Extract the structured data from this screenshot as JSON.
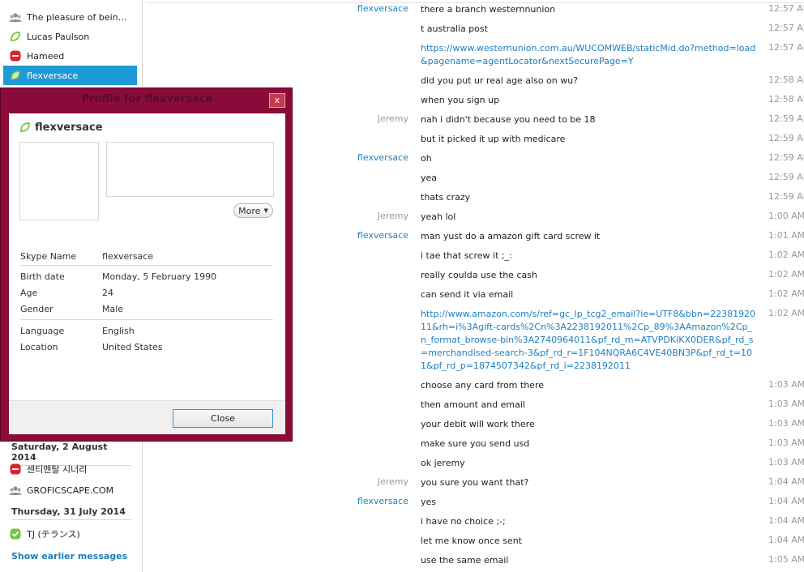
{
  "sidebar": {
    "contacts_top": [
      {
        "name": "The pleasure of being cu…",
        "icon": "group-icon"
      },
      {
        "name": "Lucas Paulson",
        "icon": "status-offline-icon"
      },
      {
        "name": "Hameed",
        "icon": "status-dnd-icon"
      },
      {
        "name": "flexversace",
        "icon": "status-offline-icon",
        "selected": true
      }
    ],
    "date_groups": [
      {
        "date": "Saturday, 2 August 2014",
        "contacts": [
          {
            "name": "센티멘탈 시너리",
            "icon": "status-dnd-icon"
          },
          {
            "name": "GROFICSCAPE.COM",
            "icon": "group-icon"
          }
        ]
      },
      {
        "date": "Thursday, 31 July 2014",
        "contacts": [
          {
            "name": "TJ (テランス)",
            "icon": "status-online-icon"
          }
        ]
      }
    ],
    "show_earlier_label": "Show earlier messages"
  },
  "chat": {
    "messages": [
      {
        "sender": "flexversace",
        "side": "them",
        "text": "there a branch westernnunion",
        "time": "12:57 AM"
      },
      {
        "sender": "",
        "side": "them",
        "text": "t australia post",
        "time": "12:57 AM"
      },
      {
        "sender": "",
        "side": "them",
        "text": "https://www.westernunion.com.au/WUCOMWEB/staticMid.do?method=load&pagename=agentLocator&nextSecurePage=Y",
        "time": "12:57 AM",
        "link": true,
        "lines": 2
      },
      {
        "sender": "",
        "side": "them",
        "text": "did you put ur real age also on wu?",
        "time": "12:58 AM"
      },
      {
        "sender": "",
        "side": "them",
        "text": "when you sign up",
        "time": "12:58 AM"
      },
      {
        "sender": "Jeremy",
        "side": "me",
        "text": "nah i didn't because you need to be 18",
        "time": "12:59 AM"
      },
      {
        "sender": "",
        "side": "me",
        "text": "but it picked it up with medicare",
        "time": "12:59 AM"
      },
      {
        "sender": "flexversace",
        "side": "them",
        "text": "oh",
        "time": "12:59 AM"
      },
      {
        "sender": "",
        "side": "them",
        "text": "yea",
        "time": "12:59 AM"
      },
      {
        "sender": "",
        "side": "them",
        "text": "thats crazy",
        "time": "12:59 AM"
      },
      {
        "sender": "Jeremy",
        "side": "me",
        "text": "yeah lol",
        "time": "1:00 AM"
      },
      {
        "sender": "flexversace",
        "side": "them",
        "text": "man yust do a amazon gift card screw it",
        "time": "1:01 AM"
      },
      {
        "sender": "",
        "side": "them",
        "text": "i tae that screw it ;_:",
        "time": "1:02 AM"
      },
      {
        "sender": "",
        "side": "them",
        "text": "really coulda use the cash",
        "time": "1:02 AM"
      },
      {
        "sender": "",
        "side": "them",
        "text": "can send it via email",
        "time": "1:02 AM"
      },
      {
        "sender": "",
        "side": "them",
        "text": "http://www.amazon.com/s/ref=gc_lp_tcg2_email?ie=UTF8&bbn=2238192011&rh=i%3Agift-cards%2Cn%3A2238192011%2Cp_89%3AAmazon%2Cp_n_format_browse-bin%3A2740964011&pf_rd_m=ATVPDKIKX0DER&pf_rd_s=merchandised-search-3&pf_rd_r=1F104NQRA6C4VE40BN3P&pf_rd_t=101&pf_rd_p=1874507342&pf_rd_i=2238192011",
        "time": "1:02 AM",
        "link": true,
        "lines": 5
      },
      {
        "sender": "",
        "side": "them",
        "text": "choose any card from there",
        "time": "1:03 AM"
      },
      {
        "sender": "",
        "side": "them",
        "text": "then amount and email",
        "time": "1:03 AM"
      },
      {
        "sender": "",
        "side": "them",
        "text": "your debit will work there",
        "time": "1:03 AM"
      },
      {
        "sender": "",
        "side": "them",
        "text": "make sure you send usd",
        "time": "1:03 AM"
      },
      {
        "sender": "",
        "side": "them",
        "text": "ok jeremy",
        "time": "1:03 AM"
      },
      {
        "sender": "Jeremy",
        "side": "me",
        "text": "you sure you want that?",
        "time": "1:04 AM"
      },
      {
        "sender": "flexversace",
        "side": "them",
        "text": "yes",
        "time": "1:04 AM"
      },
      {
        "sender": "",
        "side": "them",
        "text": "i have no choice ;-;",
        "time": "1:04 AM"
      },
      {
        "sender": "",
        "side": "them",
        "text": "let me know once sent",
        "time": "1:04 AM"
      },
      {
        "sender": "",
        "side": "them",
        "text": "use the same email",
        "time": "1:05 AM"
      }
    ]
  },
  "profile_dialog": {
    "title": "Profile for flexversace",
    "close_x": "x",
    "name": "flexversace",
    "more_label": "More",
    "fields_a": [
      {
        "label": "Skype Name",
        "value": "flexversace"
      }
    ],
    "fields_b": [
      {
        "label": "Birth date",
        "value": "Monday, 5 February 1990"
      },
      {
        "label": "Age",
        "value": "24"
      },
      {
        "label": "Gender",
        "value": "Male"
      }
    ],
    "fields_c": [
      {
        "label": "Language",
        "value": "English"
      },
      {
        "label": "Location",
        "value": "United States"
      }
    ],
    "close_button": "Close"
  },
  "colors": {
    "accent": "#1e9ad6",
    "link": "#1e7fc1",
    "dialog_frame": "#8a0b3a",
    "offline": "#7cc243",
    "dnd": "#e0202f"
  }
}
